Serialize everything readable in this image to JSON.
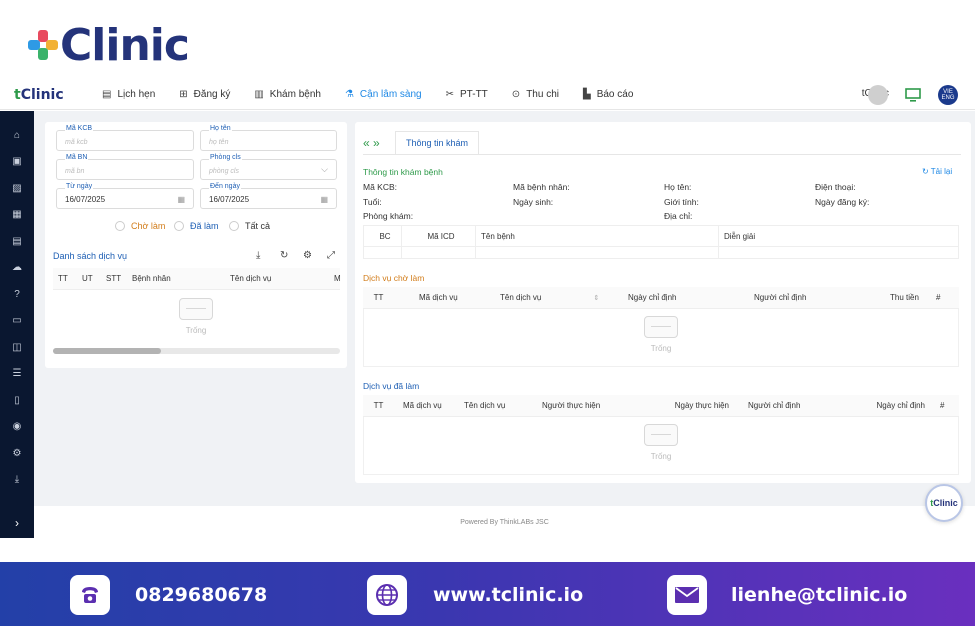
{
  "brand": {
    "name": "Clinic"
  },
  "nav": {
    "logo": "Clinic",
    "items": [
      {
        "icon": "calendar-icon",
        "label": "Lịch hẹn"
      },
      {
        "icon": "plus-square-icon",
        "label": "Đăng ký"
      },
      {
        "icon": "clipboard-icon",
        "label": "Khám bệnh"
      },
      {
        "icon": "flask-icon",
        "label": "Cận lâm sàng",
        "active": true
      },
      {
        "icon": "scissors-icon",
        "label": "PT-TT"
      },
      {
        "icon": "dollar-icon",
        "label": "Thu chi"
      },
      {
        "icon": "chart-icon",
        "label": "Báo cáo"
      }
    ],
    "user": "tClinic",
    "lang_top": "VIE",
    "lang_bottom": "ENG"
  },
  "filters": {
    "ma_kcb": {
      "label": "Mã KCB",
      "placeholder": "mã kcb"
    },
    "ho_ten": {
      "label": "Họ tên",
      "placeholder": "họ tên"
    },
    "ma_bn": {
      "label": "Mã BN",
      "placeholder": "mã bn"
    },
    "phong_cls": {
      "label": "Phòng cls",
      "placeholder": "phòng cls"
    },
    "tu_ngay": {
      "label": "Từ ngày",
      "value": "16/07/2025"
    },
    "den_ngay": {
      "label": "Đến ngày",
      "value": "16/07/2025"
    },
    "radios": [
      "Chờ làm",
      "Đã làm",
      "Tất cả"
    ]
  },
  "service_list": {
    "title": "Danh sách dịch vụ",
    "columns": [
      "TT",
      "UT",
      "STT",
      "Bệnh nhân",
      "Tên dịch vụ",
      "M"
    ],
    "empty": "Trống"
  },
  "right": {
    "tab": "Thông tin khám",
    "info_title": "Thông tin khám bệnh",
    "reload": "Tải lại",
    "labels": [
      "Mã KCB:",
      "Mã bệnh nhân:",
      "Họ tên:",
      "Điện thoại:",
      "Tuổi:",
      "Ngày sinh:",
      "Giới tính:",
      "Ngày đăng ký:",
      "Phòng khám:",
      "Địa chỉ:"
    ],
    "icd_columns": [
      "BC",
      "Mã ICD",
      "Tên bệnh",
      "Diễn giải"
    ],
    "pending_title": "Dịch vụ chờ làm",
    "pending_columns": [
      "TT",
      "Mã dịch vụ",
      "Tên dịch vụ",
      "Ngày chỉ định",
      "Người chỉ định",
      "Thu tiền",
      "#"
    ],
    "done_title": "Dịch vụ đã làm",
    "done_columns": [
      "TT",
      "Mã dịch vụ",
      "Tên dịch vụ",
      "Người thực hiện",
      "Ngày thực hiện",
      "Người chỉ định",
      "Ngày chỉ định",
      "#"
    ],
    "empty": "Trống"
  },
  "footer": "Powered By ThinkLABs JSC",
  "fab": "Clinic",
  "contact": {
    "phone": "0829680678",
    "web": "www.tclinic.io",
    "email": "lienhe@tclinic.io"
  }
}
